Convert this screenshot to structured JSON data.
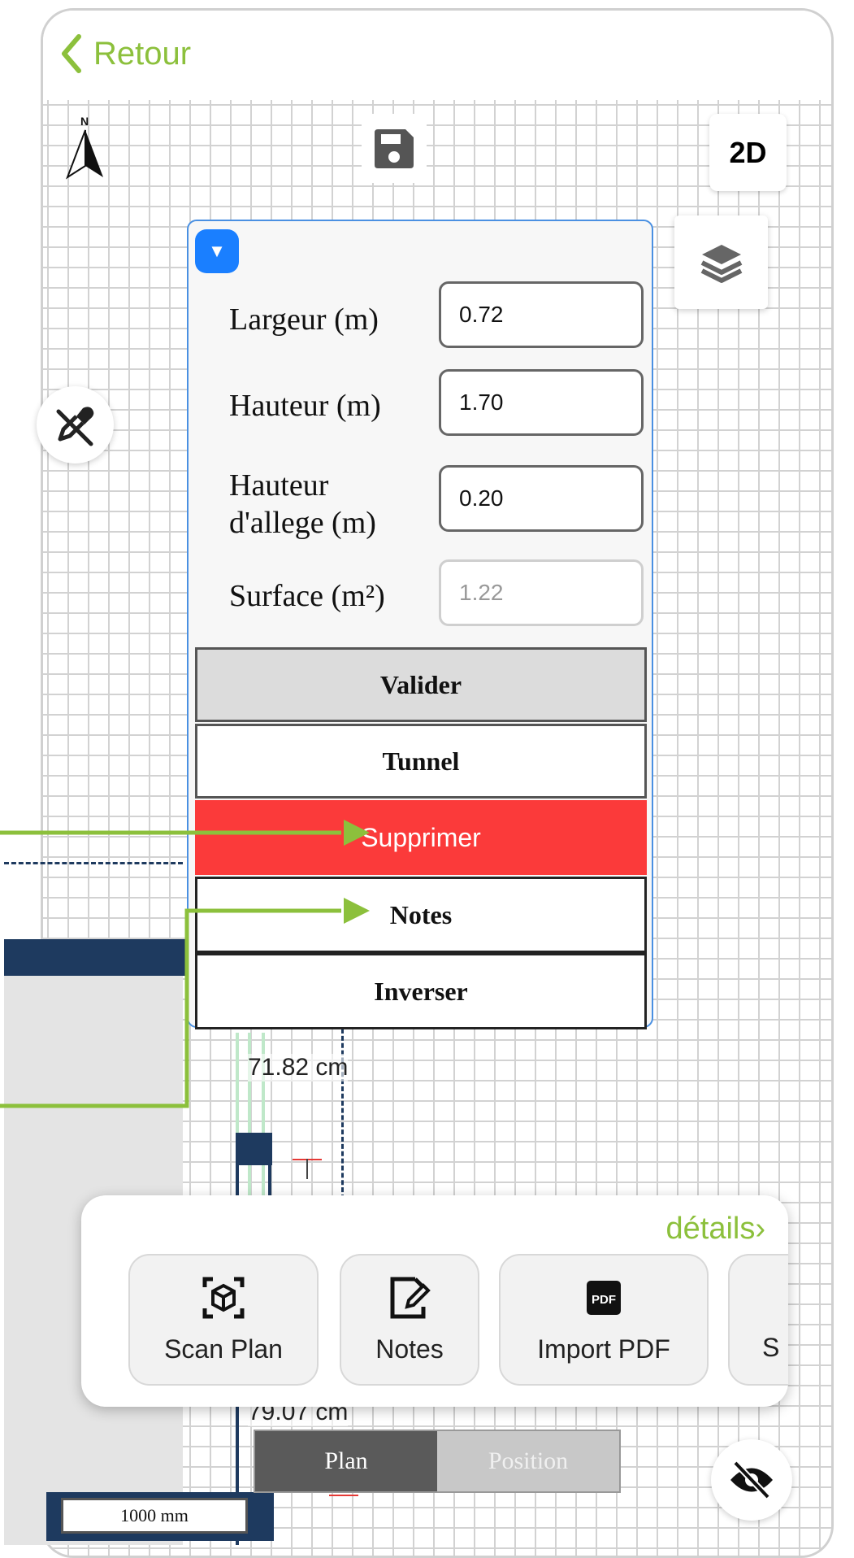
{
  "header": {
    "back_label": "Retour"
  },
  "compass": {
    "north_label": "N"
  },
  "view_toggle": {
    "label": "2D"
  },
  "panel": {
    "fields": [
      {
        "label": "Largeur (m)",
        "value": "0.72"
      },
      {
        "label": "Hauteur (m)",
        "value": "1.70"
      },
      {
        "label": "Hauteur d'allege (m)",
        "value": "0.20"
      },
      {
        "label": "Surface (m²)",
        "value": "1.22"
      }
    ],
    "buttons": {
      "validate": "Valider",
      "tunnel": "Tunnel",
      "delete": "Supprimer",
      "notes": "Notes",
      "invert": "Inverser"
    }
  },
  "measurements": [
    "71.82 cm",
    "79.07 cm"
  ],
  "toolbar": {
    "details_label": "détails›",
    "tools": [
      {
        "label": "Scan Plan",
        "icon": "scan-icon"
      },
      {
        "label": "Notes",
        "icon": "notes-edit-icon"
      },
      {
        "label": "Import PDF",
        "icon": "pdf-icon"
      },
      {
        "label": "S",
        "icon": ""
      }
    ]
  },
  "segment": {
    "plan": "Plan",
    "position": "Position"
  },
  "scale_bar": {
    "label": "1000 mm"
  },
  "colors": {
    "accent_green": "#8cc03c",
    "panel_border": "#4a90e2",
    "delete_red": "#fb3a3a",
    "wall_navy": "#1e3a5f",
    "collapse_blue": "#1a7fff"
  }
}
